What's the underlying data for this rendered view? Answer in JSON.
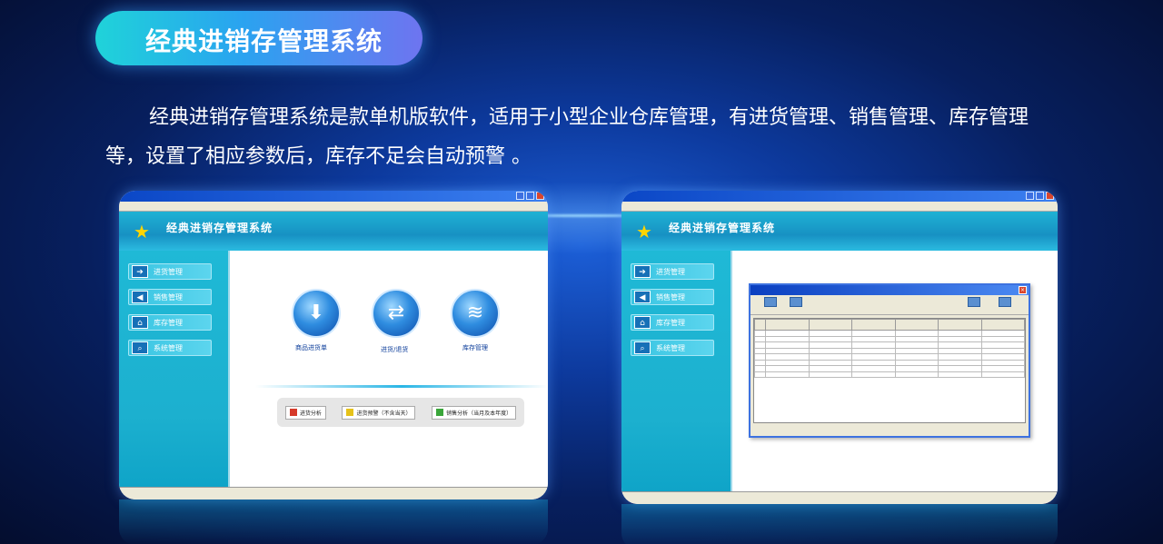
{
  "header": {
    "title": "经典进销存管理系统",
    "description": "经典进销存管理系统是款单机版软件，适用于小型企业仓库管理，有进货管理、销售管理、库存管理等，设置了相应参数后，库存不足会自动预警 。"
  },
  "colors": {
    "pill_start": "#1fd3d9",
    "pill_end": "#6e74f0",
    "app_teal": "#1cb0cf"
  },
  "left_shot": {
    "sidebar": [
      {
        "label": "进货管理",
        "icon": "arrow-in-icon"
      },
      {
        "label": "销售管理",
        "icon": "arrow-out-icon"
      },
      {
        "label": "库存管理",
        "icon": "house-icon"
      },
      {
        "label": "系统管理",
        "icon": "magnifier-icon"
      }
    ],
    "banner_title": "经典进销存管理系统",
    "circle_buttons": [
      {
        "label": "商品进货单",
        "icon": "download-icon"
      },
      {
        "label": "进货/退货",
        "icon": "swap-icon"
      },
      {
        "label": "库存管理",
        "icon": "stack-icon"
      }
    ],
    "alerts": [
      "进货分析",
      "进货预警（不含当天）",
      "销售分析（当月及本年度）"
    ]
  },
  "right_shot": {
    "sidebar": [
      {
        "label": "进货管理",
        "icon": "arrow-in-icon"
      },
      {
        "label": "销售管理",
        "icon": "arrow-out-icon"
      },
      {
        "label": "库存管理",
        "icon": "house-icon"
      },
      {
        "label": "系统管理",
        "icon": "magnifier-icon"
      }
    ],
    "banner_title": "经典进销存管理系统"
  }
}
